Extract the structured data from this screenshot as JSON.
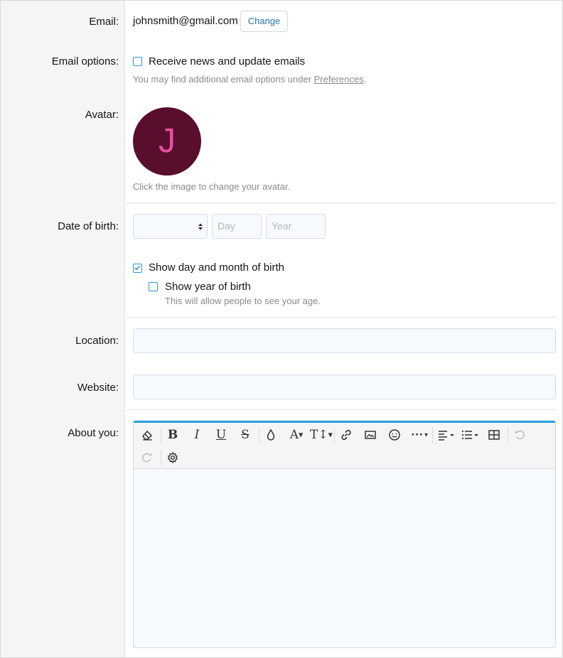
{
  "labels": {
    "email": "Email:",
    "email_options": "Email options:",
    "avatar": "Avatar:",
    "dob": "Date of birth:",
    "location": "Location:",
    "website": "Website:",
    "about": "About you:"
  },
  "email": {
    "value": "johnsmith@gmail.com",
    "change_label": "Change"
  },
  "email_options": {
    "checkbox_label": "Receive news and update emails",
    "checked": false,
    "hint_prefix": "You may find additional email options under ",
    "hint_link": "Preferences",
    "hint_suffix": "."
  },
  "avatar": {
    "letter": "J",
    "bg_color": "#5a0e2e",
    "letter_color": "#e84ea0",
    "hint": "Click the image to change your avatar."
  },
  "dob": {
    "month_value": "",
    "day_placeholder": "Day",
    "year_placeholder": "Year",
    "show_day_month_label": "Show day and month of birth",
    "show_day_month_checked": true,
    "show_year_label": "Show year of birth",
    "show_year_checked": false,
    "show_year_hint": "This will allow people to see your age."
  },
  "location": {
    "value": ""
  },
  "website": {
    "value": ""
  },
  "editor": {
    "accent_color": "#2a9fe0",
    "toolbar_icons": [
      "eraser-icon",
      "bold-icon",
      "italic-icon",
      "underline-icon",
      "strikethrough-icon",
      "color-drop-icon",
      "font-family-icon",
      "font-size-icon",
      "link-icon",
      "image-icon",
      "smiley-icon",
      "more-icon",
      "align-icon",
      "list-icon",
      "table-icon",
      "undo-icon",
      "redo-icon",
      "gear-icon"
    ],
    "content": ""
  }
}
